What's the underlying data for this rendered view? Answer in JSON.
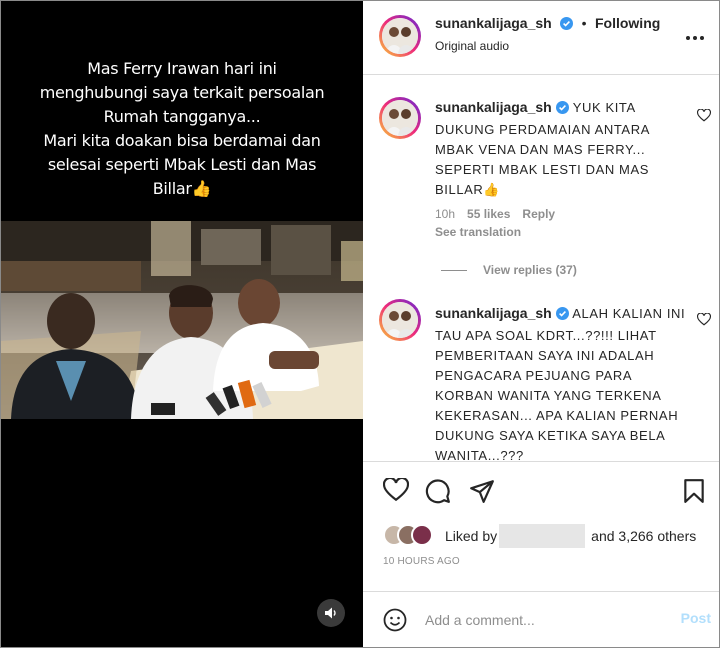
{
  "video": {
    "caption_lines": [
      "Mas Ferry Irawan hari ini",
      "menghubungi saya terkait persoalan",
      "Rumah tangganya...",
      "Mari kita doakan bisa berdamai dan",
      "selesai seperti Mbak Lesti dan Mas",
      "Billar👍"
    ]
  },
  "header": {
    "username": "sunankalijaga_sh",
    "dot": "•",
    "follow_status": "Following",
    "subtitle": "Original audio"
  },
  "comments": [
    {
      "username": "sunankalijaga_sh",
      "text": "YUK KITA DUKUNG PERDAMAIAN ANTARA MBAK VENA DAN MAS FERRY... SEPERTI MBAK LESTI DAN MAS BILLAR👍",
      "time": "10h",
      "likes": "55 likes",
      "reply": "Reply",
      "translation": "See translation",
      "view_replies": "View replies (37)"
    },
    {
      "username": "sunankalijaga_sh",
      "text": "ALAH KALIAN INI TAU APA SOAL KDRT...??!!! LIHAT PEMBERITAAN SAYA INI ADALAH PENGACARA PEJUANG PARA KORBAN WANITA YANG TERKENA KEKERASAN... APA KALIAN PERNAH DUKUNG SAYA KETIKA SAYA BELA WANITA...???"
    }
  ],
  "likes": {
    "prefix": "Liked by",
    "suffix": "and 3,266 others"
  },
  "timestamp": "10 HOURS AGO",
  "add_comment": {
    "placeholder": "Add a comment...",
    "post": "Post"
  },
  "colors": {
    "verified": "#3897f0",
    "post_disabled": "#b2dffc",
    "meta_gray": "#8e8e8e"
  }
}
